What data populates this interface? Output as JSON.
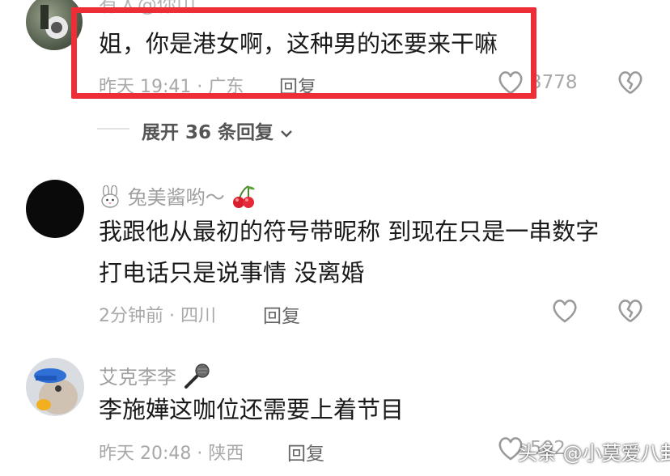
{
  "comments": [
    {
      "username": "有人@你山",
      "text": "姐，你是港女啊，这种男的还要来干嘛",
      "meta": "昨天 19:41 · 广东",
      "reply_label": "回复",
      "like_count": "3778"
    },
    {
      "username": "兔美酱哟～",
      "line1": "我跟他从最初的符号带昵称 到现在只是一串数字",
      "line2": "打电话只是说事情 没离婚",
      "meta": "2分钟前 · 四川",
      "reply_label": "回复"
    },
    {
      "username": "艾克李李",
      "text": "李施嬅这咖位还需要上着节目",
      "meta": "昨天 20:48 · 陕西",
      "reply_label": "回复",
      "like_count": "502"
    }
  ],
  "expand_replies": "展开 36 条回复",
  "watermark": "头条 @小莫爱八卦",
  "icons": {
    "like": "heart-outline-icon",
    "dislike": "broken-heart-icon",
    "chevron": "chevron-down-icon",
    "rabbit": "rabbit-emoji-icon",
    "cherry": "cherry-emoji-icon",
    "mic": "microphone-emoji-icon"
  },
  "colors": {
    "highlight": "#ee2e36",
    "meta": "#a8a8a8",
    "text": "#1a1a1a"
  }
}
